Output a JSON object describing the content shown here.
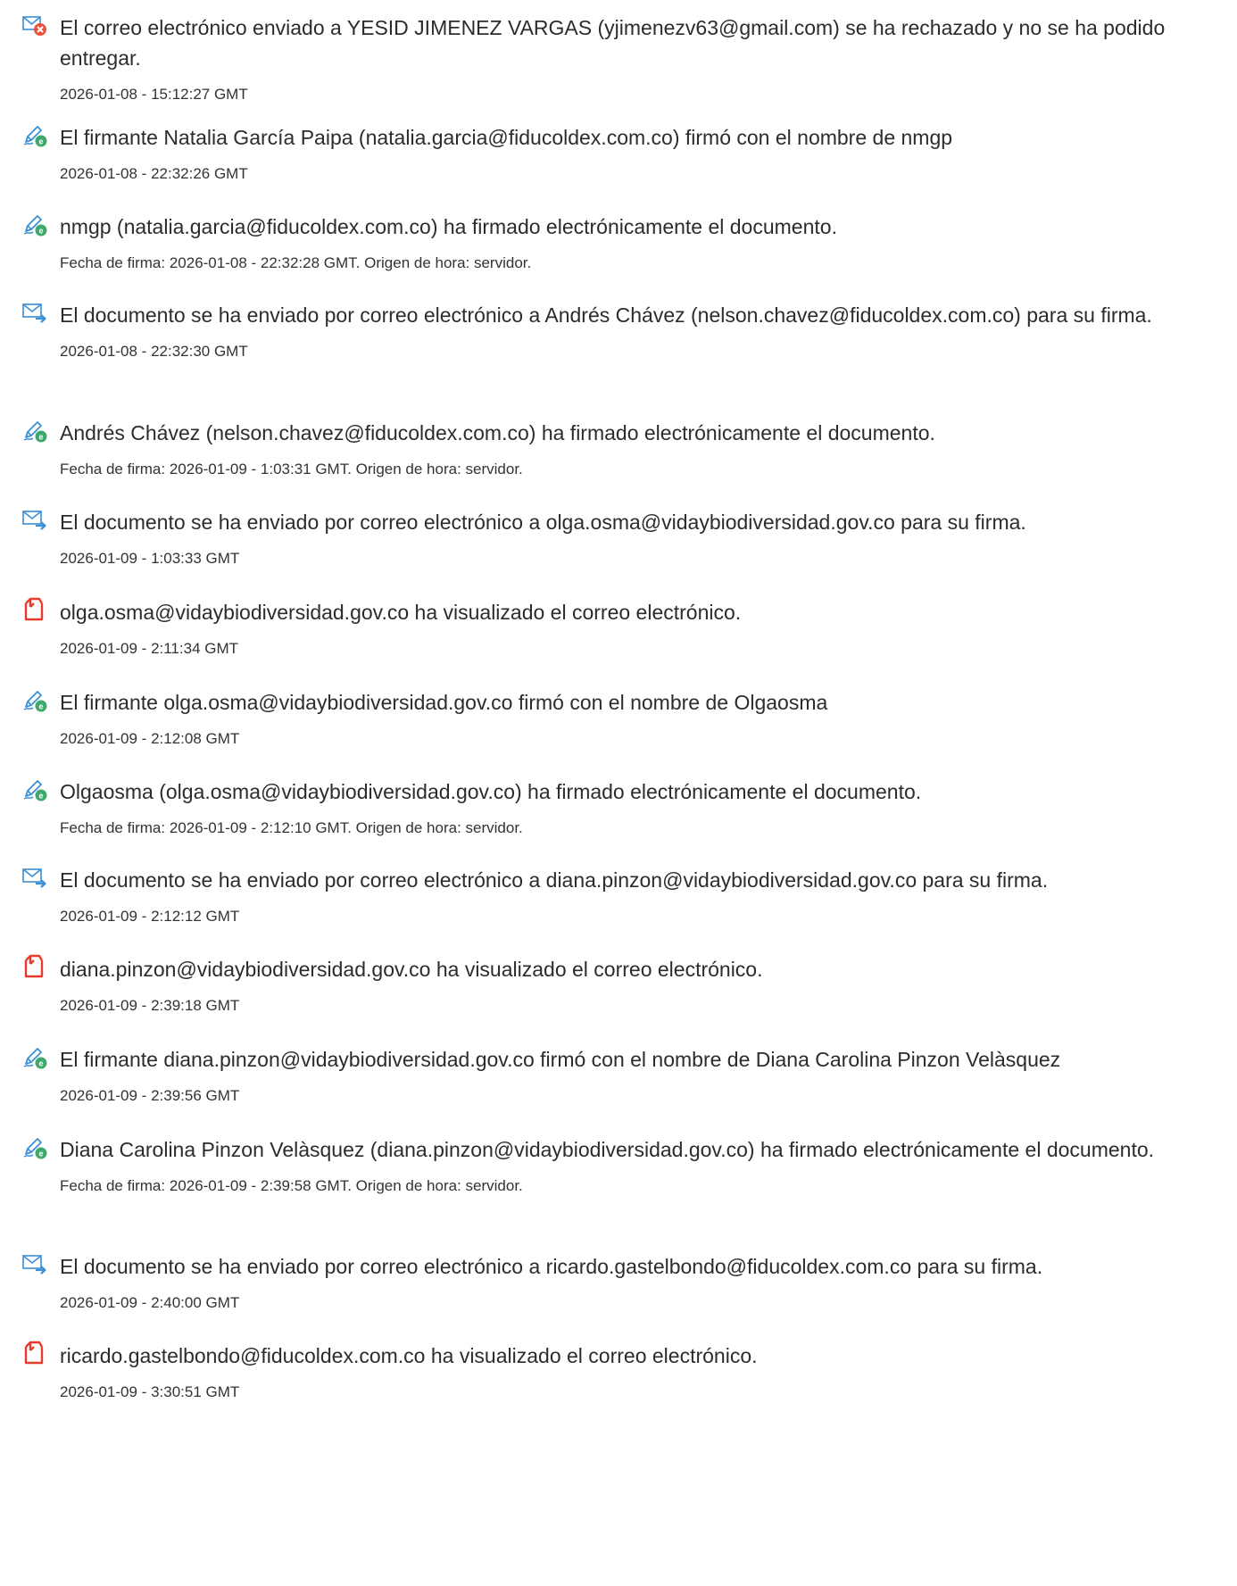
{
  "colors": {
    "text": "#2c2c2c",
    "email_blue": "#3c8fd6",
    "reject_red": "#e7533f",
    "sign_green": "#3fa86b",
    "view_red": "#e53a2c"
  },
  "events": [
    {
      "icon": "email-rejected-icon",
      "text": "El correo electrónico enviado a YESID JIMENEZ VARGAS (yjimenezv63@gmail.com) se ha rechazado y no se ha podido entregar.",
      "sub": "2026-01-08 - 15:12:27 GMT"
    },
    {
      "icon": "signature-pen-icon",
      "text": "El firmante Natalia García Paipa (natalia.garcia@fiducoldex.com.co) firmó con el nombre de nmgp",
      "sub": "2026-01-08 - 22:32:26 GMT"
    },
    {
      "icon": "signature-pen-icon",
      "text": "nmgp (natalia.garcia@fiducoldex.com.co) ha firmado electrónicamente el documento.",
      "sub": "Fecha de firma: 2026-01-08 - 22:32:28 GMT. Origen de hora: servidor."
    },
    {
      "icon": "email-sent-icon",
      "text": "El documento se ha enviado por correo electrónico a Andrés Chávez (nelson.chavez@fiducoldex.com.co) para su firma.",
      "sub": "2026-01-08 - 22:32:30 GMT"
    },
    {
      "icon": "signature-pen-icon",
      "text": "Andrés Chávez (nelson.chavez@fiducoldex.com.co) ha firmado electrónicamente el documento.",
      "sub": "Fecha de firma: 2026-01-09 - 1:03:31 GMT. Origen de hora: servidor."
    },
    {
      "icon": "email-sent-icon",
      "text": "El documento se ha enviado por correo electrónico a olga.osma@vidaybiodiversidad.gov.co para su firma.",
      "sub": "2026-01-09 - 1:03:33 GMT"
    },
    {
      "icon": "document-viewed-icon",
      "text": "olga.osma@vidaybiodiversidad.gov.co ha visualizado el correo electrónico.",
      "sub": "2026-01-09 - 2:11:34 GMT"
    },
    {
      "icon": "signature-pen-icon",
      "text": "El firmante olga.osma@vidaybiodiversidad.gov.co firmó con el nombre de Olgaosma",
      "sub": "2026-01-09 - 2:12:08 GMT"
    },
    {
      "icon": "signature-pen-icon",
      "text": "Olgaosma (olga.osma@vidaybiodiversidad.gov.co) ha firmado electrónicamente el documento.",
      "sub": "Fecha de firma: 2026-01-09 - 2:12:10 GMT. Origen de hora: servidor."
    },
    {
      "icon": "email-sent-icon",
      "text": "El documento se ha enviado por correo electrónico a diana.pinzon@vidaybiodiversidad.gov.co para su firma.",
      "sub": "2026-01-09 - 2:12:12 GMT"
    },
    {
      "icon": "document-viewed-icon",
      "text": "diana.pinzon@vidaybiodiversidad.gov.co ha visualizado el correo electrónico.",
      "sub": "2026-01-09 - 2:39:18 GMT"
    },
    {
      "icon": "signature-pen-icon",
      "text": "El firmante diana.pinzon@vidaybiodiversidad.gov.co firmó con el nombre de Diana Carolina Pinzon Velàsquez",
      "sub": "2026-01-09 - 2:39:56 GMT"
    },
    {
      "icon": "signature-pen-icon",
      "text": "Diana Carolina Pinzon Velàsquez (diana.pinzon@vidaybiodiversidad.gov.co) ha firmado electrónicamente el documento.",
      "sub": "Fecha de firma: 2026-01-09 - 2:39:58 GMT. Origen de hora: servidor."
    },
    {
      "icon": "email-sent-icon",
      "text": "El documento se ha enviado por correo electrónico a ricardo.gastelbondo@fiducoldex.com.co para su firma.",
      "sub": "2026-01-09 - 2:40:00 GMT"
    },
    {
      "icon": "document-viewed-icon",
      "text": "ricardo.gastelbondo@fiducoldex.com.co ha visualizado el correo electrónico.",
      "sub": "2026-01-09 - 3:30:51 GMT"
    }
  ]
}
